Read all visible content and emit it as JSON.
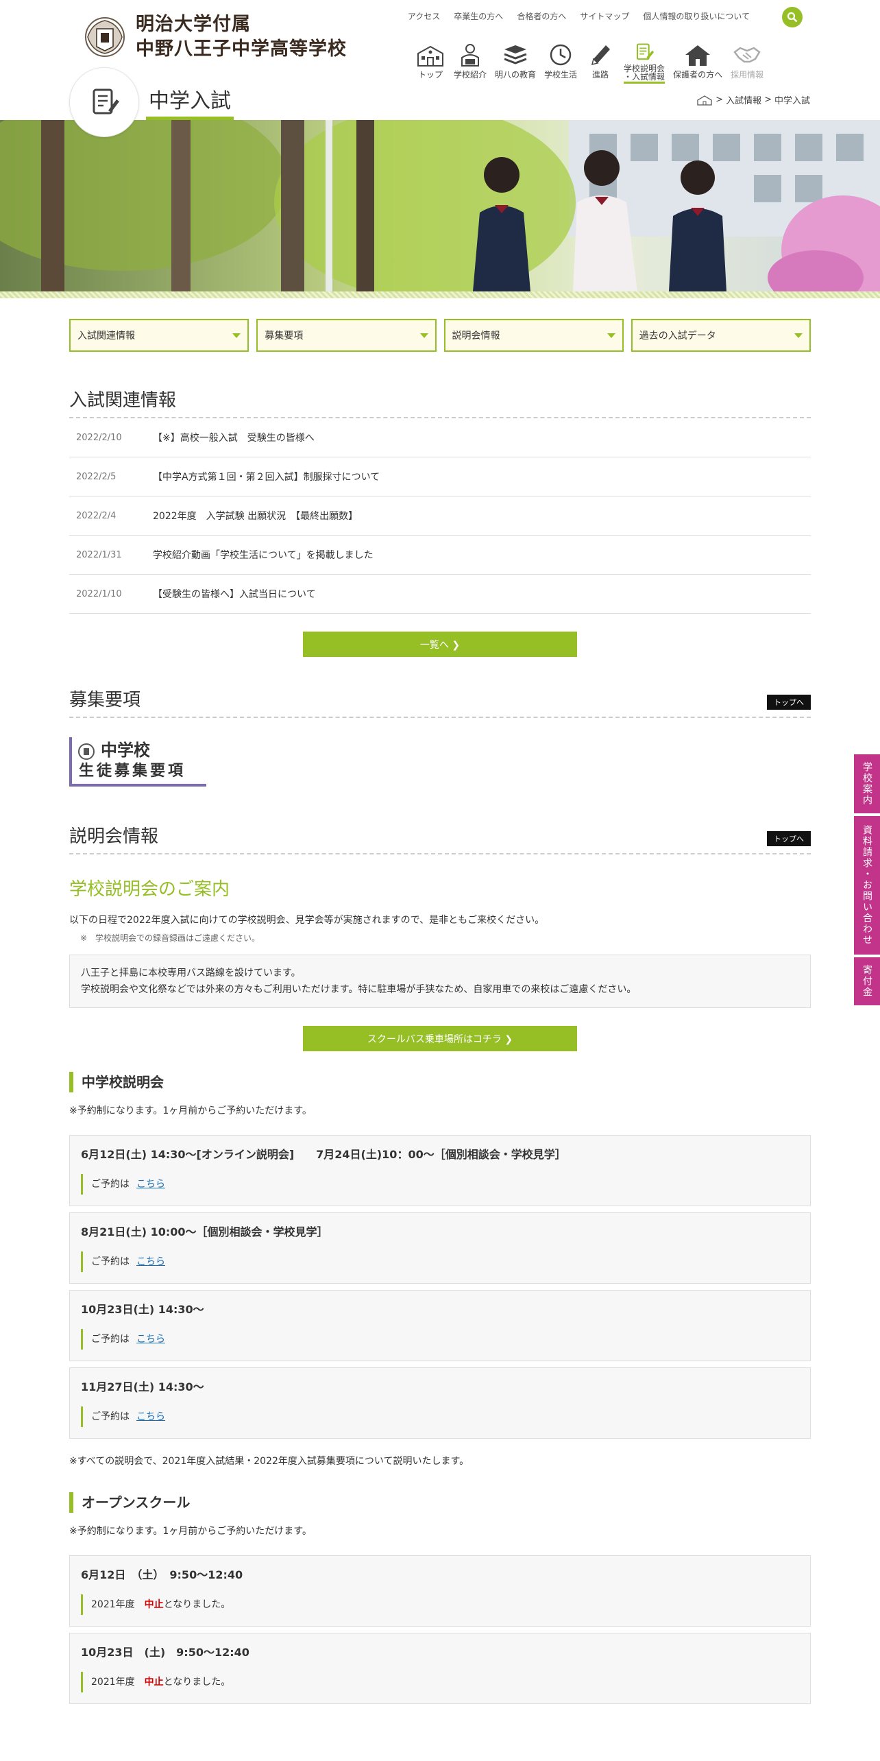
{
  "header": {
    "logo_line1": "明治大学付属",
    "logo_line2": "中野八王子中学高等学校",
    "utility_links": [
      "アクセス",
      "卒業生の方へ",
      "合格者の方へ",
      "サイトマップ",
      "個人情報の取り扱いについて"
    ],
    "nav": [
      {
        "label": "トップ",
        "icon": "school-building-icon"
      },
      {
        "label": "学校紹介",
        "icon": "student-reading-icon"
      },
      {
        "label": "明八の教育",
        "icon": "books-icon"
      },
      {
        "label": "学校生活",
        "icon": "clock-icon"
      },
      {
        "label": "進路",
        "icon": "pencil-icon"
      },
      {
        "label": "学校説明会",
        "label2": "・入試情報",
        "icon": "document-pencil-icon"
      },
      {
        "label": "保護者の方へ",
        "icon": "home-icon"
      },
      {
        "label": "採用情報",
        "icon": "handshake-icon"
      }
    ]
  },
  "page_title": "中学入試",
  "breadcrumb": {
    "sep": ">",
    "level1": "入試情報",
    "level2": "中学入試"
  },
  "dropdowns": [
    "入試関連情報",
    "募集要項",
    "説明会情報",
    "過去の入試データ"
  ],
  "news": {
    "heading": "入試関連情報",
    "items": [
      {
        "date": "2022/2/10",
        "title": "【※】高校一般入試　受験生の皆様へ"
      },
      {
        "date": "2022/2/5",
        "title": "【中学A方式第１回・第２回入試】制服採寸について"
      },
      {
        "date": "2022/2/4",
        "title": "2022年度　入学試験 出願状況　【最終出願数】"
      },
      {
        "date": "2022/1/31",
        "title": "学校紹介動画「学校生活について」を掲載しました"
      },
      {
        "date": "2022/1/10",
        "title": "【受験生の皆様へ】入試当日について"
      }
    ],
    "more_button": "一覧へ ❯"
  },
  "boshu": {
    "heading": "募集要項",
    "top_link": "トップへ",
    "banner_line1": "中学校",
    "banner_line2": "生徒募集要項"
  },
  "setsumei": {
    "heading": "説明会情報",
    "top_link": "トップへ",
    "subheading": "学校説明会のご案内",
    "intro": "以下の日程で2022年度入試に向けての学校説明会、見学会等が実施されますので、是非ともご来校ください。",
    "note": "※　学校説明会での録音録画はご遠慮ください。",
    "bus_box_line1": "八王子と拝島に本校専用バス路線を設けています。",
    "bus_box_line2": "学校説明会や文化祭などでは外来の方々もご利用いただけます。特に駐車場が手狭なため、自家用車での来校はご遠慮ください。",
    "bus_button": "スクールバス乗車場所はコチラ ❯"
  },
  "chugaku": {
    "heading": "中学校説明会",
    "note": "※予約制になります。1ヶ月前からご予約いただけます。",
    "events": [
      {
        "title": "6月12日(土) 14:30～[オンライン説明会]　　7月24日(土)10：00～［個別相談会・学校見学］",
        "res_label": "ご予約は",
        "res_link": "こちら"
      },
      {
        "title": "8月21日(土) 10:00～［個別相談会・学校見学］",
        "res_label": "ご予約は",
        "res_link": "こちら"
      },
      {
        "title": "10月23日(土) 14:30～",
        "res_label": "ご予約は",
        "res_link": "こちら"
      },
      {
        "title": "11月27日(土) 14:30～",
        "res_label": "ご予約は",
        "res_link": "こちら"
      }
    ],
    "footnote": "※すべての説明会で、2021年度入試結果・2022年度入試募集要項について説明いたします。"
  },
  "open_school": {
    "heading": "オープンスクール",
    "note": "※予約制になります。1ヶ月前からご予約いただけます。",
    "events": [
      {
        "title": "6月12日　（土）　9:50～12:40",
        "pre": "2021年度",
        "status": "中止",
        "post": "となりました。"
      },
      {
        "title": "10月23日　(土)　9:50～12:40",
        "pre": "2021年度",
        "status": "中止",
        "post": "となりました。"
      }
    ]
  },
  "side_tabs": [
    "学校案内",
    "資料請求・お問い合わせ",
    "寄付金"
  ],
  "colors": {
    "accent": "#95bf25",
    "side_tab": "#c23489",
    "alert": "#d20000"
  }
}
